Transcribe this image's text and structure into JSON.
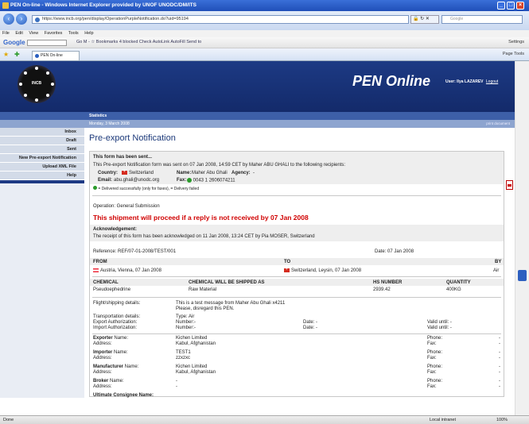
{
  "window": {
    "title": "PEN On-line - Windows Internet Explorer provided by UNOF UNODC/DM/ITS",
    "url": "https://www.incb.org/pen/display/OperationPurpleNotification.do?uid=95194",
    "search_placeholder": "Google",
    "menu": [
      "File",
      "Edit",
      "View",
      "Favorites",
      "Tools",
      "Help"
    ],
    "google_label": "Google",
    "google_tools": "Go  M -  ☆ Bookmarks  4 blocked  Check  AutoLink  AutoFill  Send to",
    "settings_label": "Settings",
    "tab_title": "PEN On-line",
    "tab_tools": "Page  Tools",
    "status_left": "Done",
    "status_zone": "Local intranet",
    "status_zoom": "100%"
  },
  "header": {
    "logo_text": "INCB",
    "app_title": "PEN Online",
    "user_label": "User: Ilya LAZAREV",
    "logout": "Logout",
    "section": "Statistics",
    "date": "Monday, 3 March 2008",
    "print": "print document"
  },
  "sidebar": {
    "items": [
      "Inbox",
      "Draft",
      "Sent",
      "New Pre-export Notification",
      "Upload XML File",
      "Help"
    ]
  },
  "main": {
    "title": "Pre-export Notification",
    "sent_heading": "This form has been sent...",
    "sent_text": "This Pre-export Notification form was sent on 07 Jan 2008, 14:59 CET by Maher ABU GHALI to the following recipients:",
    "country_label": "Country:",
    "country_value": "Switzerland",
    "name_label": "Name:",
    "name_value": "Maher Abu Ghali",
    "agency_label": "Agency:",
    "agency_value": "-",
    "email_label": "Email:",
    "email_value": "abu.ghali@unodc.org",
    "fax_label": "Fax:",
    "fax_value": "0043 1 2606074211",
    "legend": "= Delivered successfully (only for faxes),  = Delivery failed",
    "operation": "Operation: General Submission",
    "warning": "This shipment will proceed if a reply is not received by 07 Jan 2008",
    "ack_heading": "Acknowledgement:",
    "ack_text": "The receipt of this form has been acknowledged on 11 Jan 2008, 13:24 CET by Pia MOSER, Switzerland",
    "reference": "Reference: REF/07-01-2008/TEST/001",
    "ref_date": "Date: 07 Jan 2008",
    "from_label": "FROM",
    "to_label": "TO",
    "by_label": "BY",
    "from_value": "Austria, Vienna, 07 Jan 2008",
    "to_value": "Switzerland, Leysin, 07 Jan 2008",
    "by_value": "Air",
    "chem_headers": [
      "CHEMICAL",
      "CHEMICAL WILL BE SHIPPED AS",
      "HS NUMBER",
      "QUANTITY"
    ],
    "chem_row": [
      "Pseudoephedrine",
      "Raw Material",
      "2939.42",
      "400KG"
    ],
    "flight_label": "Flight/shipping details:",
    "flight_value_1": "This is a test message from Maher Abu Ghali x4211",
    "flight_value_2": "Please, disregard this PEN.",
    "transport_label": "Transportation details:",
    "transport_value": "Type: Air",
    "export_label": "Export Authorization:",
    "import_label": "Import Authorization:",
    "auth_number": "Number:-",
    "auth_date": "Date: -",
    "auth_valid": "Valid until: -",
    "parties": [
      {
        "role": "Exporter",
        "name": "Kichen Limited",
        "address": "Kabul, Afghanistan"
      },
      {
        "role": "Importer",
        "name": "TEST1",
        "address": "zzxzxc"
      },
      {
        "role": "Manufacturer",
        "name": "Kichen Limited",
        "address": "Kabul, Afghanistan"
      },
      {
        "role": "Broker",
        "name": "-",
        "address": "-"
      }
    ],
    "name_word": "Name:",
    "address_word": "Address:",
    "phone_word": "Phone:",
    "fax_word": "Fax:",
    "dash": "-",
    "last_party": "Ultimate Consignee Name:"
  }
}
